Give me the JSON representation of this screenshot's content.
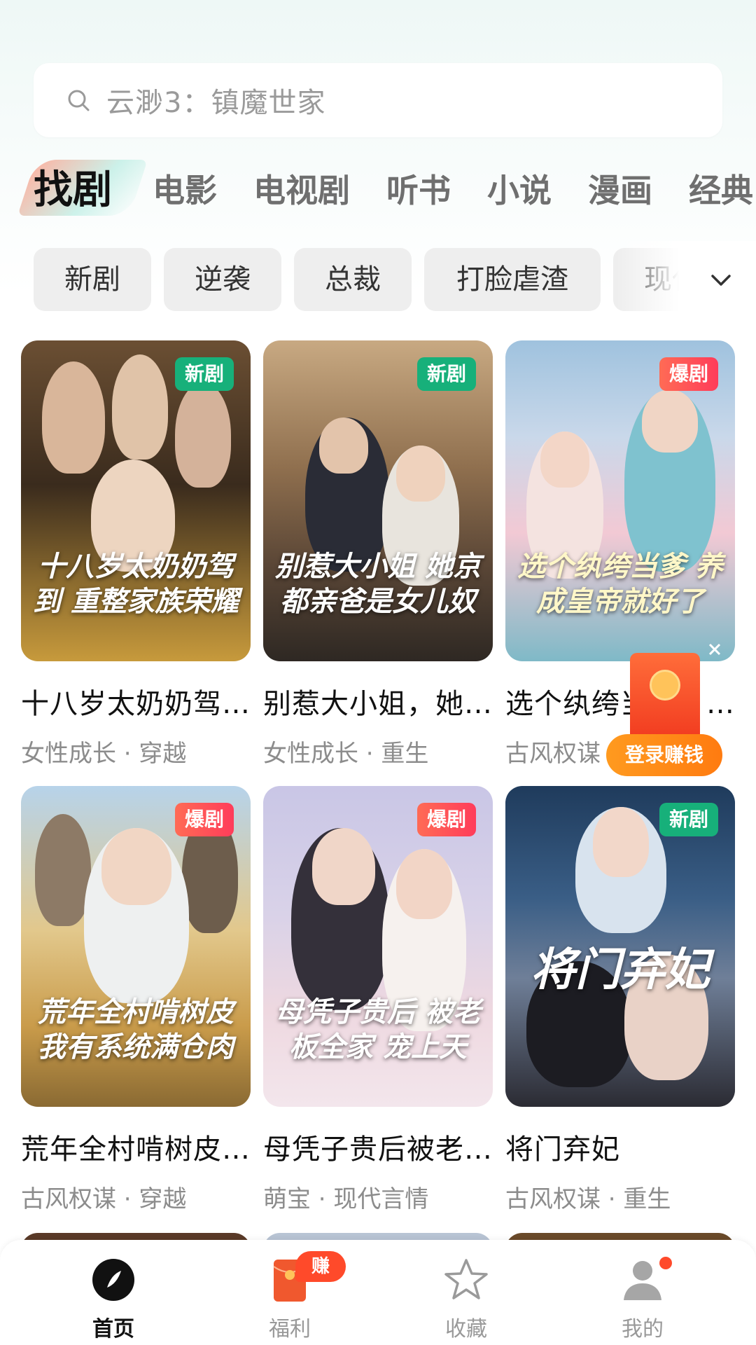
{
  "search": {
    "placeholder": "云渺3：镇魔世家"
  },
  "tabs": [
    "找剧",
    "电影",
    "电视剧",
    "听书",
    "小说",
    "漫画",
    "经典"
  ],
  "active_tab": "找剧",
  "chips": [
    "新剧",
    "逆袭",
    "总裁",
    "打脸虐渣",
    "现代"
  ],
  "cards": [
    {
      "title": "十八岁太奶奶驾到，重整家族荣耀",
      "tags": "女性成长 · 穿越",
      "badge": "新剧",
      "poster_text": "十八岁太奶奶驾到 重整家族荣耀"
    },
    {
      "title": "别惹大小姐，她京都亲爸是女儿奴",
      "tags": "女性成长 · 重生",
      "badge": "新剧",
      "poster_text": "别惹大小姐 她京都亲爸是女儿奴"
    },
    {
      "title": "选个纨绔当爹，养成皇帝就好了",
      "tags": "古风权谋 · 穿越",
      "badge": "爆剧",
      "poster_text": "选个纨绔当爹 养成皇帝就好了"
    },
    {
      "title": "荒年全村啃树皮，我有系统满仓肉",
      "tags": "古风权谋 · 穿越",
      "badge": "爆剧",
      "poster_text": "荒年全村啃树皮 我有系统满仓肉"
    },
    {
      "title": "母凭子贵后被老板全家宠上天",
      "tags": "萌宝 · 现代言情",
      "badge": "爆剧",
      "poster_text": "母凭子贵后 被老板全家 宠上天"
    },
    {
      "title": "将门弃妃",
      "tags": "古风权谋 · 重生",
      "badge": "新剧",
      "poster_text": "将门弃妃"
    }
  ],
  "float_reward": {
    "label": "登录赚钱"
  },
  "bottom_nav": [
    {
      "label": "首页",
      "icon": "compass-icon"
    },
    {
      "label": "福利",
      "icon": "red-envelope-icon",
      "badge": "赚钱"
    },
    {
      "label": "收藏",
      "icon": "star-icon"
    },
    {
      "label": "我的",
      "icon": "user-icon"
    }
  ],
  "colors": {
    "accent_green": "#17b07a",
    "accent_red": "#ff3c5a",
    "accent_orange": "#ff7b10"
  }
}
